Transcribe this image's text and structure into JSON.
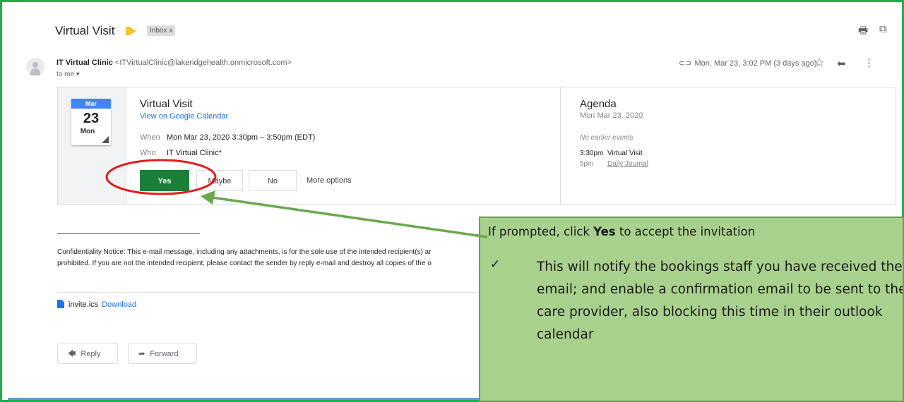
{
  "email": {
    "subject": "Virtual Visit",
    "label": "Inbox",
    "label_close": "x",
    "sender_name": "IT Virtual Clinic",
    "sender_address": "<ITVirtualClinic@lakeridgehealth.onmicrosoft.com>",
    "to": "to me",
    "date": "Mon, Mar 23, 3:02 PM (3 days ago)"
  },
  "icons": {
    "print": "printer-icon",
    "open": "open-in-new-window-icon",
    "star": "star-icon",
    "reply": "reply-icon",
    "more": "more-vertical-icon",
    "attachment": "paperclip-icon"
  },
  "invite": {
    "cal_month": "Mar",
    "cal_day": "23",
    "cal_dow": "Mon",
    "title": "Virtual Visit",
    "view_link": "View on Google Calendar",
    "when_label": "When",
    "when_value": "Mon Mar 23, 2020 3:30pm – 3:50pm (EDT)",
    "who_label": "Who",
    "who_value": "IT Virtual Clinic*",
    "yes": "Yes",
    "maybe": "Maybe",
    "no": "No",
    "more_options": "More options"
  },
  "agenda": {
    "title": "Agenda",
    "date": "Mon Mar 23, 2020",
    "no_earlier": "No earlier events",
    "events": [
      {
        "time": "3:30pm",
        "name": "Virtual Visit"
      },
      {
        "time": "5pm",
        "name": "Daily Journal"
      }
    ]
  },
  "body": {
    "confidentiality_line1": "Confidentiality Notice: This e-mail message, including any attachments, is for the sole use of the intended recipient(s) ar",
    "confidentiality_line2": "prohibited. If you are not the intended recipient, please contact the sender by reply e-mail and destroy all copies of the o"
  },
  "attachment": {
    "filename": "invite.ics",
    "download": "Download"
  },
  "actions": {
    "reply": "Reply",
    "forward": "Forward"
  },
  "callout": {
    "heading_pre": "If prompted, click ",
    "heading_bold": "Yes",
    "heading_post": " to accept the invitation",
    "check": "✓",
    "bullet": "This will notify the bookings staff you have received the email; and enable a confirmation email to be sent to the care provider, also blocking this time in their outlook calendar"
  },
  "colors": {
    "frame_border": "#1fae4b",
    "yes_button": "#188038",
    "link": "#1a73e8",
    "callout_bg": "#a9d18e",
    "highlight_circle": "#e31b1b",
    "arrow": "#6aa84f"
  }
}
